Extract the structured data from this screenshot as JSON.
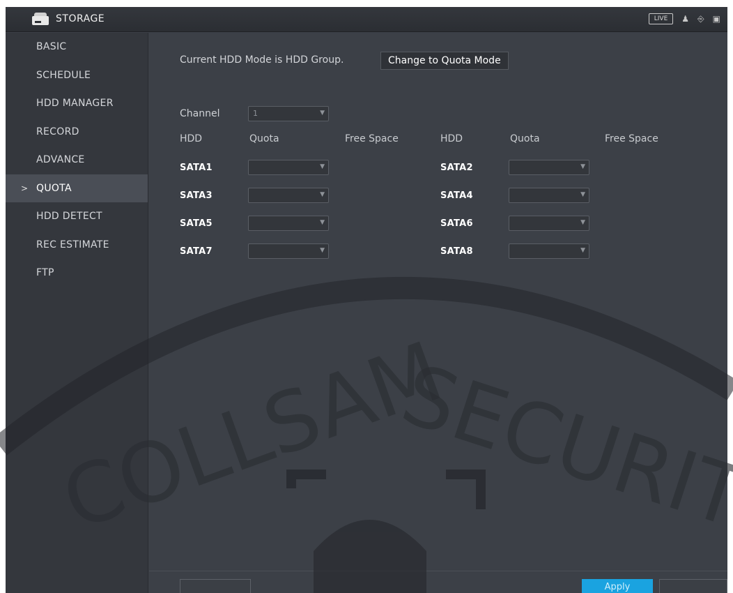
{
  "topbar": {
    "title": "STORAGE",
    "live_label": "LIVE",
    "icons": [
      "hdd-icon",
      "user-icon",
      "logout-icon",
      "exit-icon"
    ]
  },
  "sidebar": {
    "items": [
      {
        "label": "BASIC",
        "active": false
      },
      {
        "label": "SCHEDULE",
        "active": false
      },
      {
        "label": "HDD MANAGER",
        "active": false
      },
      {
        "label": "RECORD",
        "active": false
      },
      {
        "label": "ADVANCE",
        "active": false
      },
      {
        "label": "QUOTA",
        "active": true
      },
      {
        "label": "HDD DETECT",
        "active": false
      },
      {
        "label": "REC ESTIMATE",
        "active": false
      },
      {
        "label": "FTP",
        "active": false
      }
    ],
    "active_marker": ">"
  },
  "main": {
    "mode_text": "Current HDD Mode is HDD Group.",
    "change_button": "Change to Quota Mode",
    "channel_label": "Channel",
    "channel_value": "1",
    "headers": {
      "hdd": "HDD",
      "quota": "Quota",
      "free_space": "Free Space"
    },
    "rows": [
      {
        "left": {
          "hdd": "SATA1"
        },
        "right": {
          "hdd": "SATA2"
        }
      },
      {
        "left": {
          "hdd": "SATA3"
        },
        "right": {
          "hdd": "SATA4"
        }
      },
      {
        "left": {
          "hdd": "SATA5"
        },
        "right": {
          "hdd": "SATA6"
        }
      },
      {
        "left": {
          "hdd": "SATA7"
        },
        "right": {
          "hdd": "SATA8"
        }
      }
    ]
  },
  "buttons": {
    "apply": "Apply"
  },
  "watermark": {
    "text": "COLLSAM SECURITY"
  },
  "colors": {
    "background": "#3c4047",
    "sidebar": "#34373d",
    "active_item": "#4a4e56",
    "apply_button": "#1aa3e0"
  }
}
